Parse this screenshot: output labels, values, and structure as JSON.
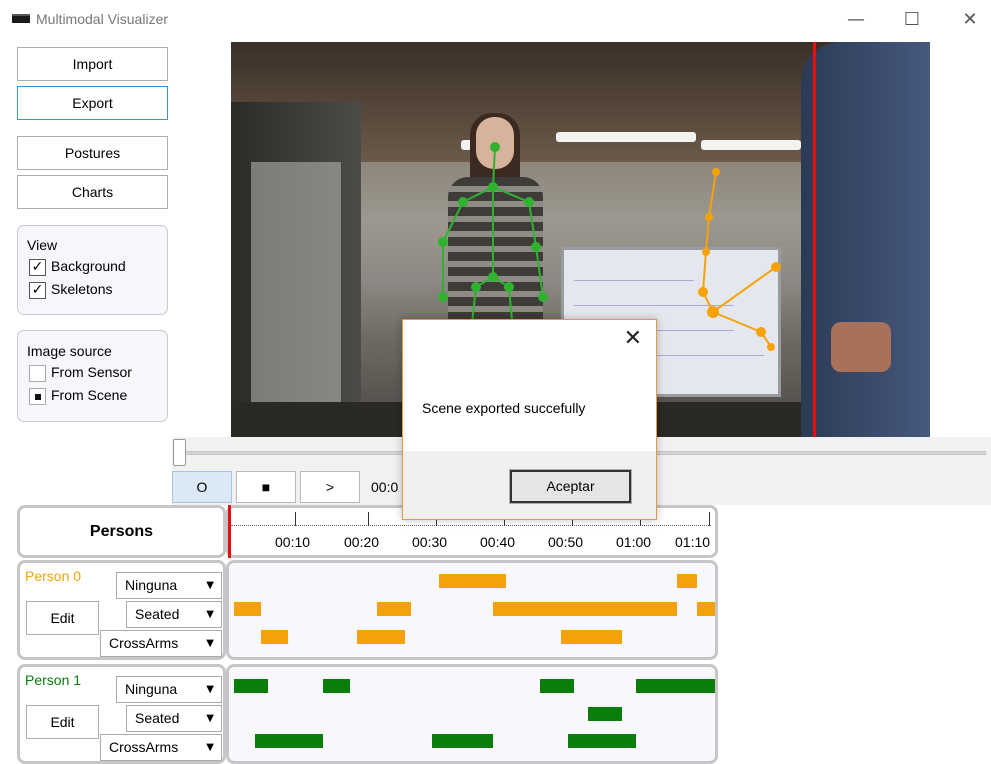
{
  "window": {
    "title": "Multimodal Visualizer",
    "minimize_glyph": "—",
    "maximize_glyph": "☐",
    "close_glyph": "✕"
  },
  "sidebar": {
    "import_label": "Import",
    "export_label": "Export",
    "postures_label": "Postures",
    "charts_label": "Charts",
    "view": {
      "title": "View",
      "background": {
        "label": "Background",
        "checked": true,
        "glyph": "✓"
      },
      "skeletons": {
        "label": "Skeletons",
        "checked": true,
        "glyph": "✓"
      }
    },
    "image_source": {
      "title": "Image source",
      "from_sensor": {
        "label": "From Sensor",
        "selected": false
      },
      "from_scene": {
        "label": "From Scene",
        "selected": true
      }
    }
  },
  "player": {
    "record_label": "O",
    "stop_label": "■",
    "play_label": ">",
    "time": "00:0",
    "slider_position": 0
  },
  "timeline": {
    "header_label": "Persons",
    "ticks": [
      "00:10",
      "00:20",
      "00:30",
      "00:40",
      "00:50",
      "01:00",
      "01:10"
    ]
  },
  "persons": [
    {
      "name": "Person 0",
      "color": "#f5a20a",
      "combos": [
        "Ninguna",
        "Seated",
        "CrossArms"
      ],
      "edit_label": "Edit"
    },
    {
      "name": "Person 1",
      "color": "#0a7d0a",
      "combos": [
        "Ninguna",
        "Seated",
        "CrossArms"
      ],
      "edit_label": "Edit"
    }
  ],
  "dialog": {
    "message": "Scene exported succefully",
    "ok_label": "Aceptar",
    "close_glyph": "✕"
  },
  "icons": {
    "dropdown_arrow": "▼"
  }
}
